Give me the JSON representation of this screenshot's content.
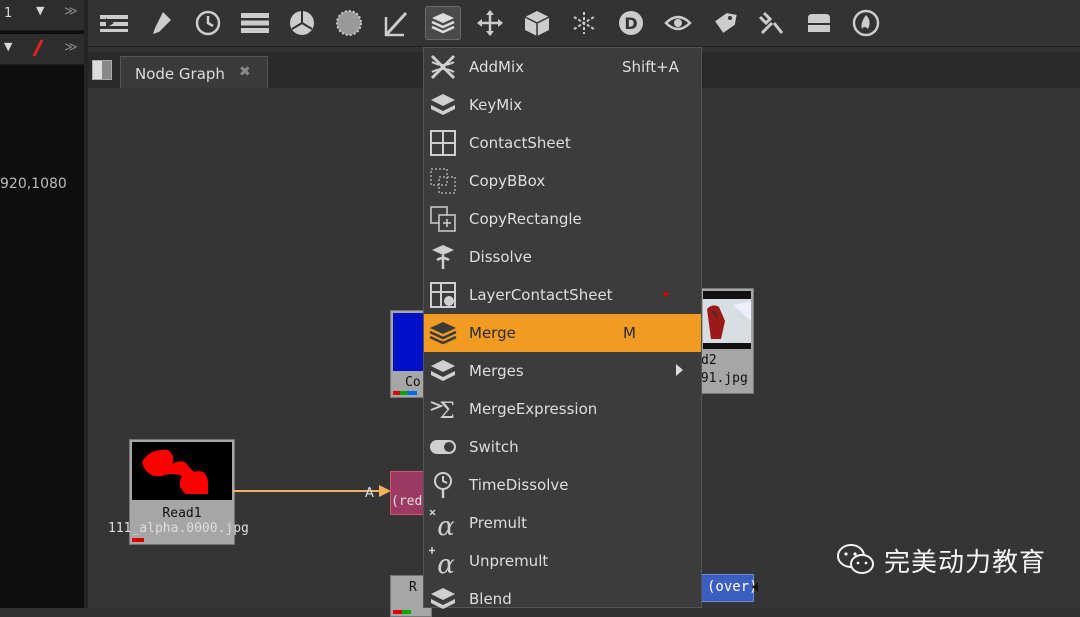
{
  "left_panel": {
    "frame_value": "1",
    "coords_text": "920,1080"
  },
  "toolbar": {
    "icons": [
      "input-icon",
      "paint-icon",
      "time-icon",
      "channel-icon",
      "color-icon",
      "filter-icon",
      "keyer-icon",
      "merge-icon",
      "transform-icon",
      "3d-icon",
      "particles-icon",
      "deep-icon",
      "views-icon",
      "metadata-icon",
      "toolsets-icon",
      "other-icon",
      "furnace-icon"
    ]
  },
  "tabs": [
    {
      "label": "Node Graph",
      "close": "✖"
    }
  ],
  "menu": {
    "items": [
      {
        "label": "AddMix",
        "shortcut": "Shift+A",
        "icon": "addmix-icon"
      },
      {
        "label": "KeyMix",
        "shortcut": "",
        "icon": "keymix-icon"
      },
      {
        "label": "ContactSheet",
        "shortcut": "",
        "icon": "contactsheet-icon"
      },
      {
        "label": "CopyBBox",
        "shortcut": "",
        "icon": "copybbox-icon"
      },
      {
        "label": "CopyRectangle",
        "shortcut": "",
        "icon": "copyrectangle-icon"
      },
      {
        "label": "Dissolve",
        "shortcut": "",
        "icon": "dissolve-icon"
      },
      {
        "label": "LayerContactSheet",
        "shortcut": "",
        "icon": "layercontactsheet-icon"
      },
      {
        "label": "Merge",
        "shortcut": "M",
        "icon": "merge-icon",
        "highlighted": true
      },
      {
        "label": "Merges",
        "shortcut": "",
        "icon": "merges-icon",
        "submenu": true
      },
      {
        "label": "MergeExpression",
        "shortcut": "",
        "icon": "mergeexpression-icon"
      },
      {
        "label": "Switch",
        "shortcut": "",
        "icon": "switch-icon"
      },
      {
        "label": "TimeDissolve",
        "shortcut": "",
        "icon": "timedissolve-icon"
      },
      {
        "label": "Premult",
        "shortcut": "",
        "icon": "premult-icon"
      },
      {
        "label": "Unpremult",
        "shortcut": "",
        "icon": "unpremult-icon"
      },
      {
        "label": "Blend",
        "shortcut": "",
        "icon": "blend-icon"
      }
    ]
  },
  "graph": {
    "read1": {
      "name": "Read1",
      "file": "111_alpha.0000.jpg"
    },
    "read2": {
      "name_partial": "d2",
      "file_partial": "191.jpg"
    },
    "constant_partial": "Co",
    "merge_partial": "(red",
    "merge_over": "(over)",
    "arrow_label": "A",
    "bottom_partial": "R"
  },
  "watermark": {
    "text": "完美动力教育"
  },
  "colors": {
    "highlight": "#f29b23",
    "link": "#f2b060"
  }
}
